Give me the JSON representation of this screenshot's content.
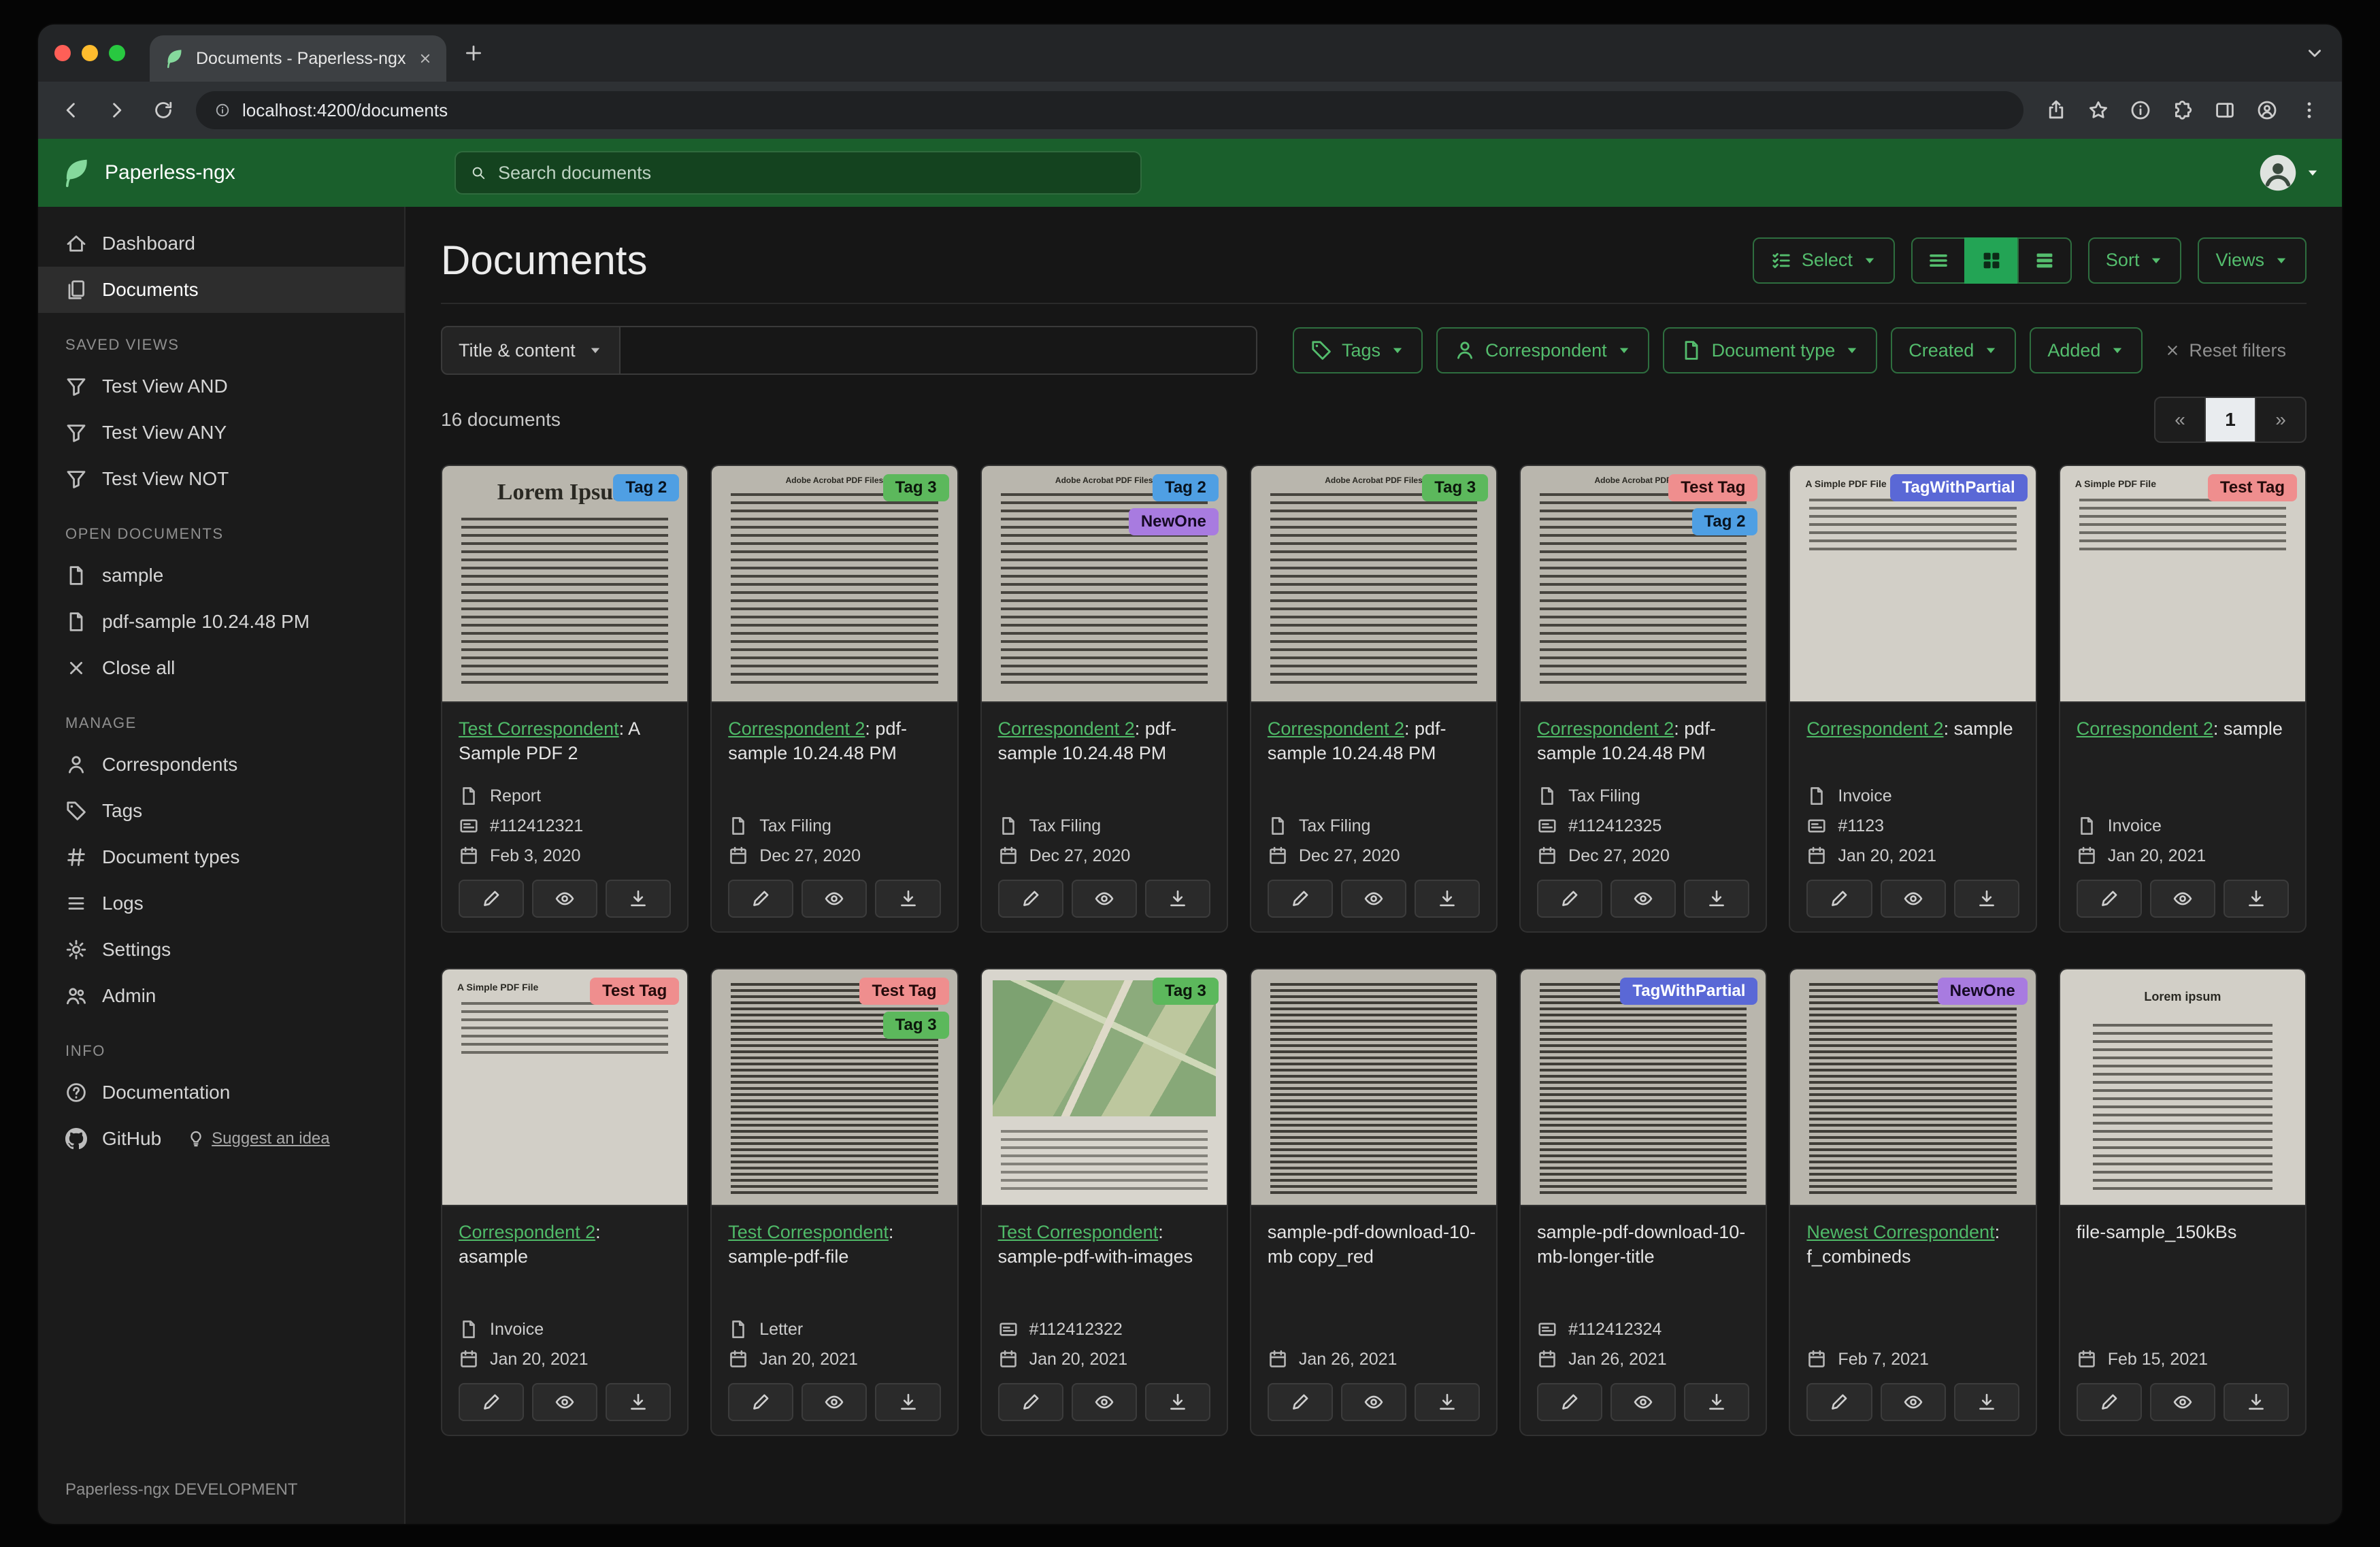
{
  "browser": {
    "tab_title": "Documents - Paperless-ngx",
    "url": "localhost:4200/documents"
  },
  "navbar": {
    "brand": "Paperless-ngx",
    "search_placeholder": "Search documents"
  },
  "sidebar": {
    "primary": [
      {
        "label": "Dashboard",
        "icon": "dashboard-icon"
      },
      {
        "label": "Documents",
        "icon": "documents-icon",
        "active": true
      }
    ],
    "sections": [
      {
        "title": "SAVED VIEWS",
        "items": [
          {
            "label": "Test View AND",
            "icon": "filter-icon"
          },
          {
            "label": "Test View ANY",
            "icon": "filter-icon"
          },
          {
            "label": "Test View NOT",
            "icon": "filter-icon"
          }
        ]
      },
      {
        "title": "OPEN DOCUMENTS",
        "items": [
          {
            "label": "sample",
            "icon": "file-icon"
          },
          {
            "label": "pdf-sample 10.24.48 PM",
            "icon": "file-icon"
          },
          {
            "label": "Close all",
            "icon": "close-icon"
          }
        ]
      },
      {
        "title": "MANAGE",
        "items": [
          {
            "label": "Correspondents",
            "icon": "person-icon"
          },
          {
            "label": "Tags",
            "icon": "tag-icon"
          },
          {
            "label": "Document types",
            "icon": "hash-icon"
          },
          {
            "label": "Logs",
            "icon": "list-icon"
          },
          {
            "label": "Settings",
            "icon": "gear-icon"
          },
          {
            "label": "Admin",
            "icon": "users-icon"
          }
        ]
      },
      {
        "title": "INFO",
        "items": [
          {
            "label": "Documentation",
            "icon": "question-icon"
          },
          {
            "label": "GitHub",
            "icon": "github-icon",
            "extra": {
              "label": "Suggest an idea",
              "icon": "bulb-icon"
            }
          }
        ]
      }
    ],
    "footer": "Paperless-ngx DEVELOPMENT"
  },
  "page": {
    "title": "Documents",
    "select_label": "Select",
    "sort_label": "Sort",
    "views_label": "Views",
    "count": "16 documents",
    "pagination": {
      "prev": "«",
      "current": "1",
      "next": "»"
    }
  },
  "filters": {
    "field_label": "Title & content",
    "buttons": [
      {
        "label": "Tags",
        "icon": "tag-icon"
      },
      {
        "label": "Correspondent",
        "icon": "person-icon"
      },
      {
        "label": "Document type",
        "icon": "doc-icon"
      },
      {
        "label": "Created"
      },
      {
        "label": "Added"
      }
    ],
    "reset_label": "Reset filters"
  },
  "documents": [
    {
      "thumb": "lorem",
      "thumb_label": "Lorem Ipsum",
      "tags": [
        {
          "label": "Tag 2",
          "bg": "#4f9fe3",
          "fg": "#08131f"
        }
      ],
      "title_link": "Test Correspondent",
      "title_rest": ": A Sample PDF 2",
      "fields": [
        {
          "icon": "file-icon",
          "text": "Report"
        },
        {
          "icon": "card-icon",
          "text": "#112412321"
        },
        {
          "icon": "calendar-icon",
          "text": "Feb 3, 2020"
        }
      ]
    },
    {
      "thumb": "pdf",
      "thumb_label": "Adobe Acrobat PDF Files",
      "tags": [
        {
          "label": "Tag 3",
          "bg": "#5cb85c",
          "fg": "#0b170b"
        }
      ],
      "title_link": "Correspondent 2",
      "title_rest": ": pdf-sample 10.24.48 PM",
      "fields": [
        {
          "icon": "file-icon",
          "text": "Tax Filing"
        },
        {
          "icon": "calendar-icon",
          "text": "Dec 27, 2020"
        }
      ]
    },
    {
      "thumb": "pdf",
      "thumb_label": "Adobe Acrobat PDF Files",
      "tags": [
        {
          "label": "Tag 2",
          "bg": "#4f9fe3",
          "fg": "#08131f"
        },
        {
          "label": "NewOne",
          "bg": "#a87be0",
          "fg": "#150a24"
        }
      ],
      "title_link": "Correspondent 2",
      "title_rest": ": pdf-sample 10.24.48 PM",
      "fields": [
        {
          "icon": "file-icon",
          "text": "Tax Filing"
        },
        {
          "icon": "calendar-icon",
          "text": "Dec 27, 2020"
        }
      ]
    },
    {
      "thumb": "pdf",
      "thumb_label": "Adobe Acrobat PDF Files",
      "tags": [
        {
          "label": "Tag 3",
          "bg": "#5cb85c",
          "fg": "#0b170b"
        }
      ],
      "title_link": "Correspondent 2",
      "title_rest": ": pdf-sample 10.24.48 PM",
      "fields": [
        {
          "icon": "file-icon",
          "text": "Tax Filing"
        },
        {
          "icon": "calendar-icon",
          "text": "Dec 27, 2020"
        }
      ]
    },
    {
      "thumb": "pdf",
      "thumb_label": "Adobe Acrobat PDF Files",
      "tags": [
        {
          "label": "Test Tag",
          "bg": "#ef8e8e",
          "fg": "#240b0b"
        },
        {
          "label": "Tag 2",
          "bg": "#4f9fe3",
          "fg": "#08131f"
        }
      ],
      "title_link": "Correspondent 2",
      "title_rest": ": pdf-sample 10.24.48 PM",
      "fields": [
        {
          "icon": "file-icon",
          "text": "Tax Filing"
        },
        {
          "icon": "card-icon",
          "text": "#112412325"
        },
        {
          "icon": "calendar-icon",
          "text": "Dec 27, 2020"
        }
      ]
    },
    {
      "thumb": "simple",
      "thumb_label": "A Simple PDF File",
      "tags": [
        {
          "label": "TagWithPartial",
          "bg": "#5a68d6",
          "fg": "#ffffff"
        }
      ],
      "title_link": "Correspondent 2",
      "title_rest": ": sample",
      "fields": [
        {
          "icon": "file-icon",
          "text": "Invoice"
        },
        {
          "icon": "card-icon",
          "text": "#1123"
        },
        {
          "icon": "calendar-icon",
          "text": "Jan 20, 2021"
        }
      ]
    },
    {
      "thumb": "simple",
      "thumb_label": "A Simple PDF File",
      "tags": [
        {
          "label": "Test Tag",
          "bg": "#ef8e8e",
          "fg": "#240b0b"
        }
      ],
      "title_link": "Correspondent 2",
      "title_rest": ": sample",
      "fields": [
        {
          "icon": "file-icon",
          "text": "Invoice"
        },
        {
          "icon": "calendar-icon",
          "text": "Jan 20, 2021"
        }
      ]
    },
    {
      "thumb": "simple",
      "thumb_label": "A Simple PDF File",
      "tags": [
        {
          "label": "Test Tag",
          "bg": "#ef8e8e",
          "fg": "#240b0b"
        }
      ],
      "title_link": "Correspondent 2",
      "title_rest": ": asample",
      "fields": [
        {
          "icon": "file-icon",
          "text": "Invoice"
        },
        {
          "icon": "calendar-icon",
          "text": "Jan 20, 2021"
        }
      ]
    },
    {
      "thumb": "text",
      "thumb_label": "",
      "tags": [
        {
          "label": "Test Tag",
          "bg": "#ef8e8e",
          "fg": "#240b0b"
        },
        {
          "label": "Tag 3",
          "bg": "#5cb85c",
          "fg": "#0b170b"
        }
      ],
      "title_link": "Test Correspondent",
      "title_rest": ": sample-pdf-file",
      "fields": [
        {
          "icon": "file-icon",
          "text": "Letter"
        },
        {
          "icon": "calendar-icon",
          "text": "Jan 20, 2021"
        }
      ]
    },
    {
      "thumb": "map",
      "thumb_label": "",
      "tags": [
        {
          "label": "Tag 3",
          "bg": "#5cb85c",
          "fg": "#0b170b"
        }
      ],
      "title_link": "Test Correspondent",
      "title_rest": ": sample-pdf-with-images",
      "fields": [
        {
          "icon": "card-icon",
          "text": "#112412322"
        },
        {
          "icon": "calendar-icon",
          "text": "Jan 20, 2021"
        }
      ]
    },
    {
      "thumb": "text",
      "thumb_label": "",
      "tags": [],
      "title_link": "",
      "title_rest": "sample-pdf-download-10-mb copy_red",
      "fields": [
        {
          "icon": "calendar-icon",
          "text": "Jan 26, 2021"
        }
      ]
    },
    {
      "thumb": "text",
      "thumb_label": "",
      "tags": [
        {
          "label": "TagWithPartial",
          "bg": "#5a68d6",
          "fg": "#ffffff"
        }
      ],
      "title_link": "",
      "title_rest": "sample-pdf-download-10-mb-longer-title",
      "fields": [
        {
          "icon": "card-icon",
          "text": "#112412324"
        },
        {
          "icon": "calendar-icon",
          "text": "Jan 26, 2021"
        }
      ]
    },
    {
      "thumb": "text",
      "thumb_label": "",
      "tags": [
        {
          "label": "NewOne",
          "bg": "#a87be0",
          "fg": "#150a24"
        }
      ],
      "title_link": "Newest Correspondent",
      "title_rest": ": f_combineds",
      "fields": [
        {
          "icon": "calendar-icon",
          "text": "Feb 7, 2021"
        }
      ]
    },
    {
      "thumb": "bold",
      "thumb_label": "Lorem ipsum",
      "tags": [],
      "title_link": "",
      "title_rest": "file-sample_150kBs",
      "fields": [
        {
          "icon": "calendar-icon",
          "text": "Feb 15, 2021"
        }
      ]
    }
  ]
}
